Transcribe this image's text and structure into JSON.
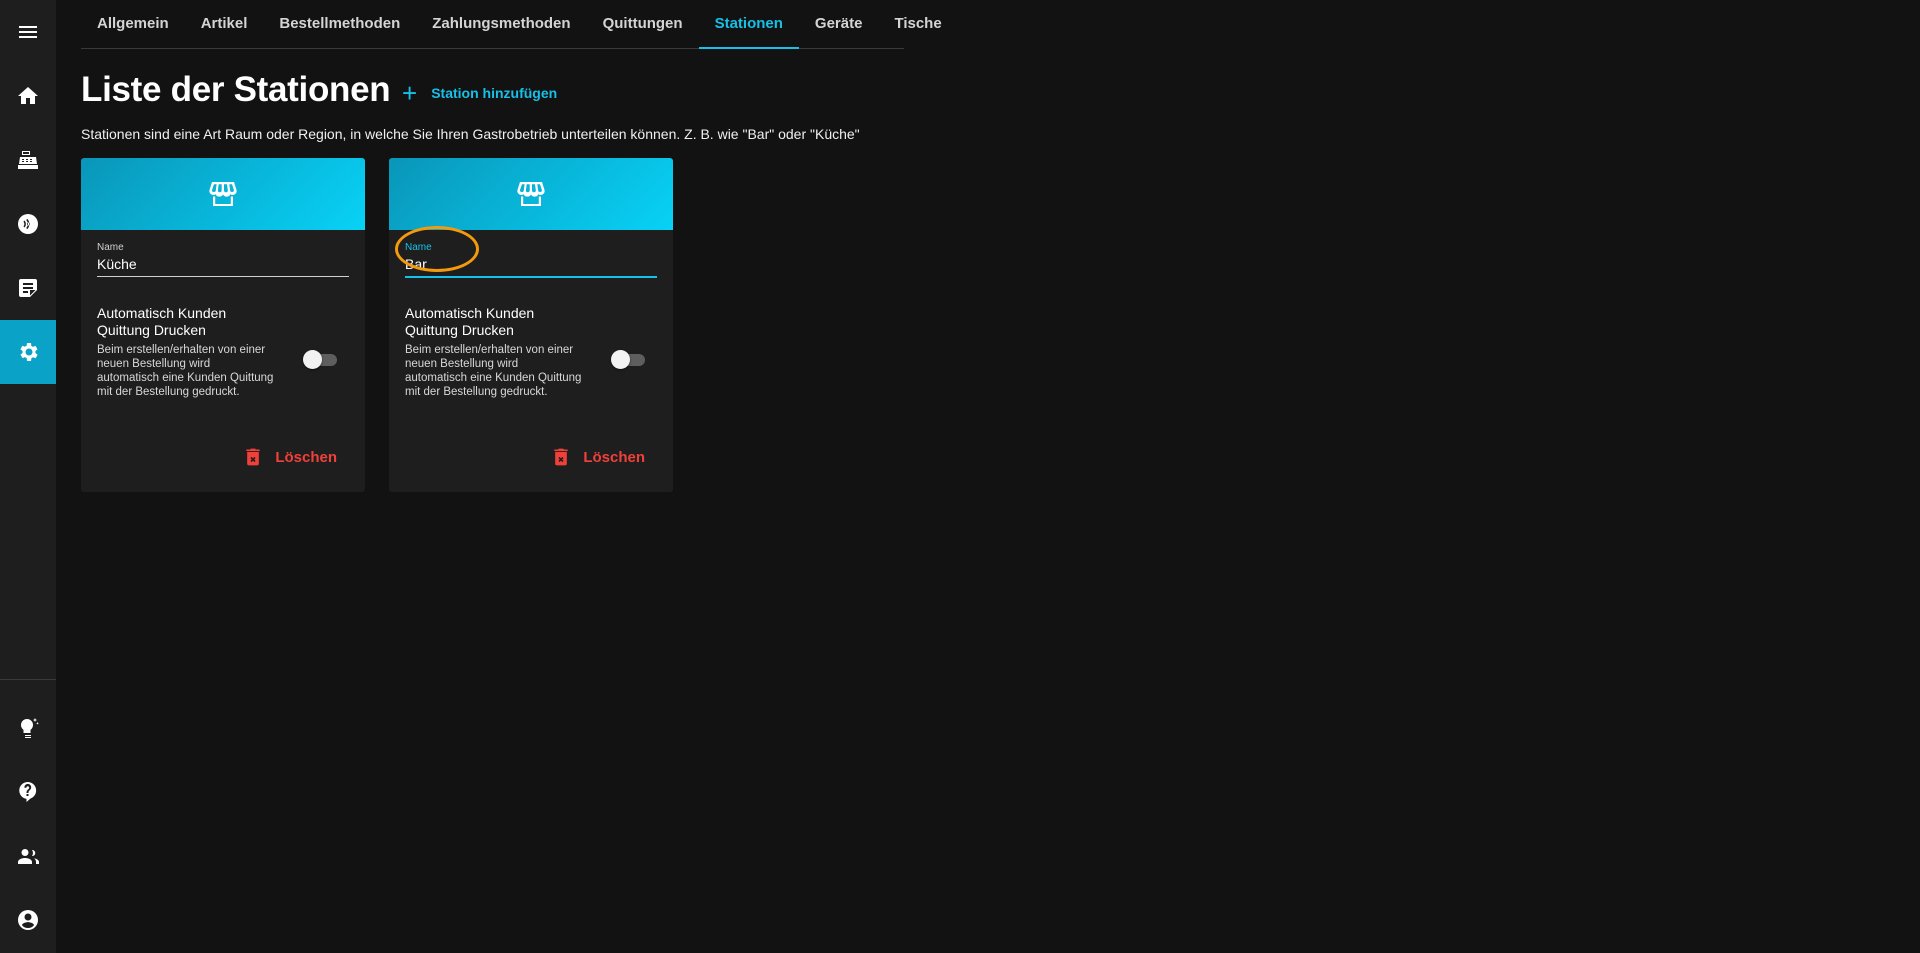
{
  "sidebar": {
    "items": [
      {
        "icon": "menu-icon"
      },
      {
        "icon": "home-icon"
      },
      {
        "icon": "cash-register-icon"
      },
      {
        "icon": "nfc-icon"
      },
      {
        "icon": "orders-icon"
      },
      {
        "icon": "settings-icon",
        "active": true
      },
      {
        "icon": "lightbulb-icon"
      },
      {
        "icon": "help-icon"
      },
      {
        "icon": "users-icon"
      },
      {
        "icon": "account-icon"
      }
    ]
  },
  "tabs": [
    {
      "label": "Allgemein"
    },
    {
      "label": "Artikel"
    },
    {
      "label": "Bestellmethoden"
    },
    {
      "label": "Zahlungsmethoden"
    },
    {
      "label": "Quittungen"
    },
    {
      "label": "Stationen",
      "active": true
    },
    {
      "label": "Geräte"
    },
    {
      "label": "Tische"
    }
  ],
  "page": {
    "title": "Liste der Stationen",
    "add_label": "Station hinzufügen",
    "description": "Stationen sind eine Art Raum oder Region, in welche Sie Ihren Gastrobetrieb unterteilen können. Z. B. wie \"Bar\" oder \"Küche\""
  },
  "stations": [
    {
      "name_label": "Name",
      "name_value": "Küche",
      "setting_title": "Automatisch Kunden Quittung Drucken",
      "setting_desc": "Beim erstellen/erhalten von einer neuen Bestellung wird automatisch eine Kunden Quittung mit der Bestellung gedruckt.",
      "auto_print_enabled": false,
      "delete_label": "Löschen"
    },
    {
      "name_label": "Name",
      "name_value": "Bar",
      "focused": true,
      "setting_title": "Automatisch Kunden Quittung Drucken",
      "setting_desc": "Beim erstellen/erhalten von einer neuen Bestellung wird automatisch eine Kunden Quittung mit der Bestellung gedruckt.",
      "auto_print_enabled": false,
      "delete_label": "Löschen"
    }
  ],
  "colors": {
    "accent": "#16c0e8",
    "danger": "#f0403a",
    "highlight": "#f39a0d",
    "background": "#121212",
    "surface": "#1e1e1e"
  }
}
